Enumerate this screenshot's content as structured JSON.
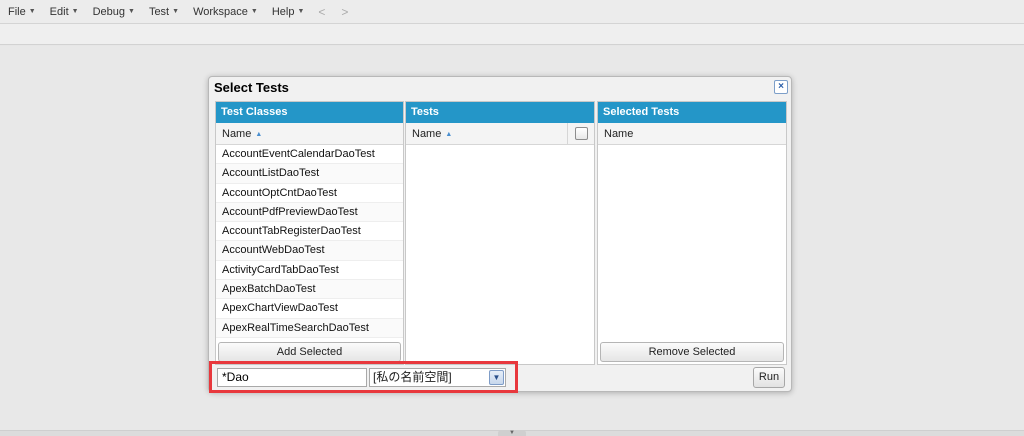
{
  "menubar": {
    "items": [
      {
        "label": "File"
      },
      {
        "label": "Edit"
      },
      {
        "label": "Debug"
      },
      {
        "label": "Test"
      },
      {
        "label": "Workspace"
      },
      {
        "label": "Help"
      }
    ],
    "back": "<",
    "forward": ">"
  },
  "dialog": {
    "title": "Select Tests",
    "close": "×",
    "test_classes": {
      "header": "Test Classes",
      "column": "Name",
      "rows": [
        "AccountEventCalendarDaoTest",
        "AccountListDaoTest",
        "AccountOptCntDaoTest",
        "AccountPdfPreviewDaoTest",
        "AccountTabRegisterDaoTest",
        "AccountWebDaoTest",
        "ActivityCardTabDaoTest",
        "ApexBatchDaoTest",
        "ApexChartViewDaoTest",
        "ApexRealTimeSearchDaoTest"
      ],
      "button": "Add Selected"
    },
    "tests": {
      "header": "Tests",
      "column": "Name"
    },
    "selected_tests": {
      "header": "Selected Tests",
      "column": "Name",
      "button": "Remove Selected"
    },
    "filter": {
      "value": "*Dao"
    },
    "namespace": {
      "selected": "[私の名前空間]"
    },
    "run_label": "Run"
  },
  "colors": {
    "panel_header": "#2496c8",
    "highlight": "#e8383d"
  }
}
